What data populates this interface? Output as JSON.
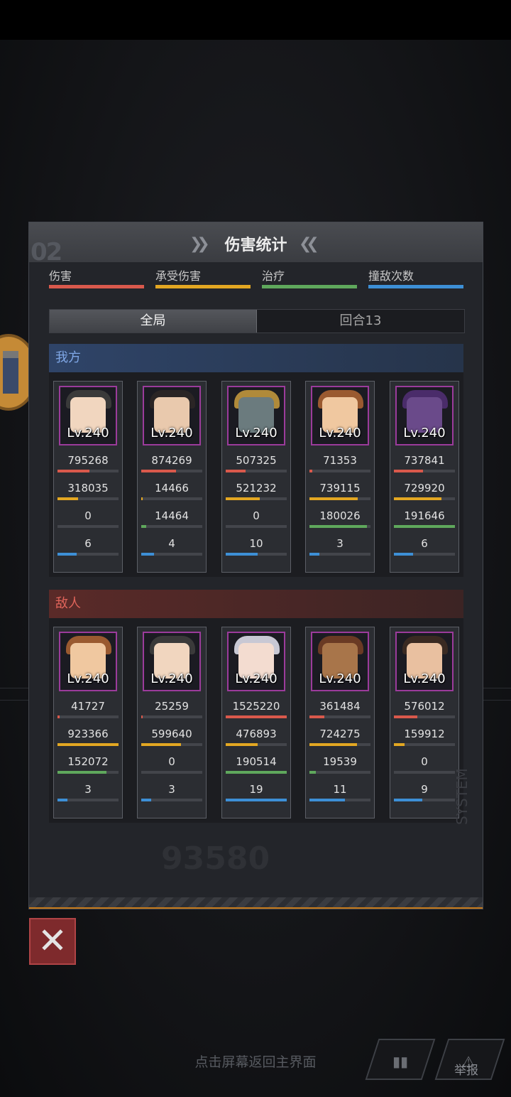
{
  "panel": {
    "title": "伤害统计",
    "bignum": "02",
    "legend": [
      {
        "label": "伤害",
        "color": "#d9594c"
      },
      {
        "label": "承受伤害",
        "color": "#e3a722"
      },
      {
        "label": "治疗",
        "color": "#5fa85c"
      },
      {
        "label": "撞敌次数",
        "color": "#3d8fd6"
      }
    ],
    "tabs": {
      "overall": "全局",
      "round": "回合13"
    },
    "ours_label": "我方",
    "enemy_label": "敌人",
    "ghost_number": "93580",
    "ghost_system": "SYSTEM"
  },
  "ours": [
    {
      "lv": "Lv.240",
      "damage": "795268",
      "taken": "318035",
      "heal": "0",
      "hits": "6",
      "dmg_frac": 0.52,
      "taken_frac": 0.34,
      "heal_frac": 0.0,
      "hits_frac": 0.31,
      "hair": "#3a3a3a",
      "skin": "#f1d6bf"
    },
    {
      "lv": "Lv.240",
      "damage": "874269",
      "taken": "14466",
      "heal": "14464",
      "hits": "4",
      "dmg_frac": 0.57,
      "taken_frac": 0.02,
      "heal_frac": 0.08,
      "hits_frac": 0.21,
      "hair": "#2a2525",
      "skin": "#e9c9ad"
    },
    {
      "lv": "Lv.240",
      "damage": "507325",
      "taken": "521232",
      "heal": "0",
      "hits": "10",
      "dmg_frac": 0.33,
      "taken_frac": 0.56,
      "heal_frac": 0.0,
      "hits_frac": 0.52,
      "hair": "#b08a3a",
      "skin": "#6b7b7e"
    },
    {
      "lv": "Lv.240",
      "damage": "71353",
      "taken": "739115",
      "heal": "180026",
      "hits": "3",
      "dmg_frac": 0.05,
      "taken_frac": 0.79,
      "heal_frac": 0.94,
      "hits_frac": 0.16,
      "hair": "#9a5a30",
      "skin": "#f0c8a0"
    },
    {
      "lv": "Lv.240",
      "damage": "737841",
      "taken": "729920",
      "heal": "191646",
      "hits": "6",
      "dmg_frac": 0.48,
      "taken_frac": 0.78,
      "heal_frac": 1.0,
      "hits_frac": 0.31,
      "hair": "#4a2c6a",
      "skin": "#6a4a8a"
    }
  ],
  "enemy": [
    {
      "lv": "Lv.240",
      "damage": "41727",
      "taken": "923366",
      "heal": "152072",
      "hits": "3",
      "dmg_frac": 0.03,
      "taken_frac": 1.0,
      "heal_frac": 0.8,
      "hits_frac": 0.16,
      "hair": "#9a5a30",
      "skin": "#f0c8a0"
    },
    {
      "lv": "Lv.240",
      "damage": "25259",
      "taken": "599640",
      "heal": "0",
      "hits": "3",
      "dmg_frac": 0.02,
      "taken_frac": 0.65,
      "heal_frac": 0.0,
      "hits_frac": 0.16,
      "hair": "#3a3a3a",
      "skin": "#f1d6bf"
    },
    {
      "lv": "Lv.240",
      "damage": "1525220",
      "taken": "476893",
      "heal": "190514",
      "hits": "19",
      "dmg_frac": 1.0,
      "taken_frac": 0.52,
      "heal_frac": 1.0,
      "hits_frac": 1.0,
      "hair": "#c8c8d4",
      "skin": "#f3dcd0"
    },
    {
      "lv": "Lv.240",
      "damage": "361484",
      "taken": "724275",
      "heal": "19539",
      "hits": "11",
      "dmg_frac": 0.24,
      "taken_frac": 0.78,
      "heal_frac": 0.1,
      "hits_frac": 0.58,
      "hair": "#6a3a24",
      "skin": "#a8754a"
    },
    {
      "lv": "Lv.240",
      "damage": "576012",
      "taken": "159912",
      "heal": "0",
      "hits": "9",
      "dmg_frac": 0.38,
      "taken_frac": 0.17,
      "heal_frac": 0.0,
      "hits_frac": 0.47,
      "hair": "#3a2a22",
      "skin": "#e9c0a0"
    }
  ],
  "footer": {
    "hint": "点击屏幕返回主界面",
    "close_icon": "close-x-icon",
    "stats_icon": "bar-chart-icon",
    "report_icon": "warning-icon",
    "report_label": "举报"
  }
}
